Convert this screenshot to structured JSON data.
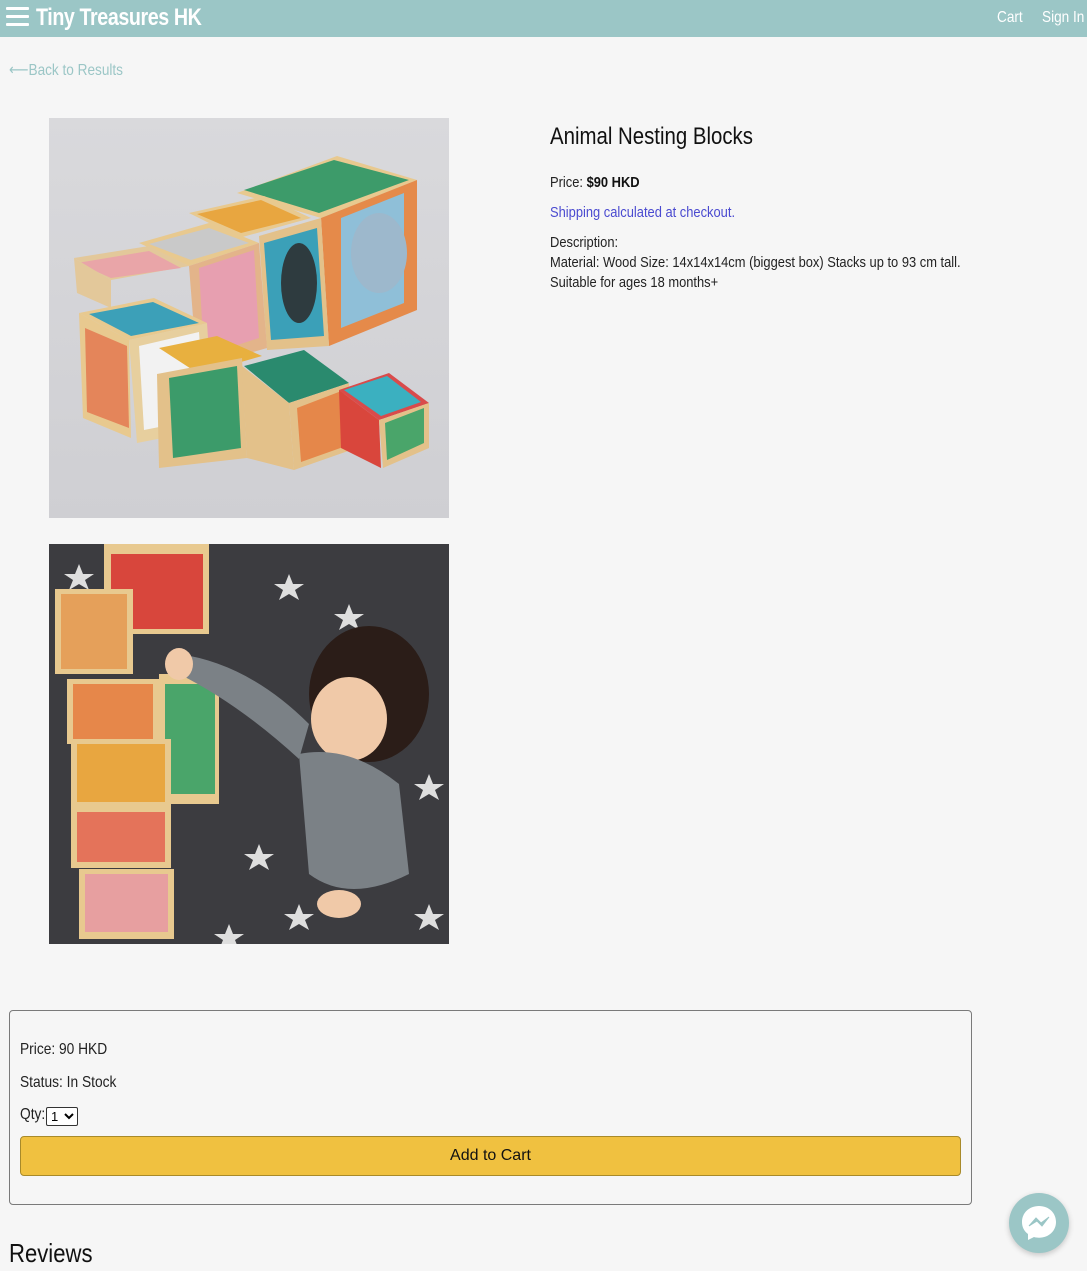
{
  "header": {
    "brand": "Tiny Treasures HK",
    "nav": {
      "cart": "Cart",
      "sign_in": "Sign In"
    }
  },
  "back_link": "⟵Back to Results",
  "product": {
    "title": "Animal Nesting Blocks",
    "price_label": "Price:",
    "price_value": "$90 HKD",
    "shipping_link": "Shipping calculated at checkout.",
    "description_label": "Description:",
    "description_line1": "Material: Wood Size: 14x14x14cm (biggest box) Stacks up to 93 cm tall.",
    "description_line2": "Suitable for ages 18 months+"
  },
  "cart_box": {
    "price": "Price: 90 HKD",
    "status": "Status: In Stock",
    "qty_label": "Qty:",
    "qty_value": "1",
    "add_button": "Add to Cart"
  },
  "reviews_heading": "Reviews",
  "icons": {
    "menu": "hamburger-menu-icon",
    "messenger": "messenger-icon"
  },
  "colors": {
    "header_bg": "#9bc6c6",
    "button_bg": "#f0c140",
    "link_blue": "#4a4ad0"
  }
}
